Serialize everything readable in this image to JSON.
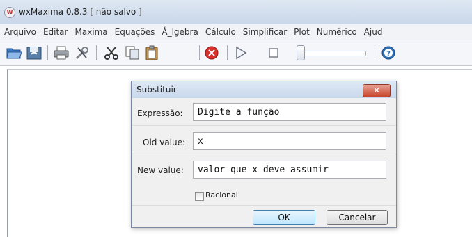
{
  "window": {
    "title": "wxMaxima 0.8.3 [ não salvo ]",
    "icon": "wxmaxima-app-icon"
  },
  "menubar": {
    "items": [
      "Arquivo",
      "Editar",
      "Maxima",
      "Equações",
      "Á_lgebra",
      "Cálculo",
      "Simplificar",
      "Plot",
      "Numérico",
      "Ajud"
    ]
  },
  "toolbar": {
    "icons": [
      "open-folder-icon",
      "save-icon",
      "print-icon",
      "settings-tools-icon",
      "cut-icon",
      "copy-icon",
      "paste-icon",
      "stop-icon",
      "play-icon",
      "square-stop-icon",
      "slider",
      "help-icon"
    ]
  },
  "dialog": {
    "title": "Substituir",
    "close_label": "✕",
    "expression_label": "Expressão:",
    "expression_value": "Digite a função",
    "old_label": "Old value:",
    "old_value": "x",
    "new_label": "New value:",
    "new_value": "valor que x deve assumir",
    "rational_label": "Racional",
    "rational_checked": false,
    "ok_label": "OK",
    "cancel_label": "Cancelar"
  },
  "colors": {
    "close_button": "#c8442c",
    "ok_button_border": "#3c7fb1"
  }
}
